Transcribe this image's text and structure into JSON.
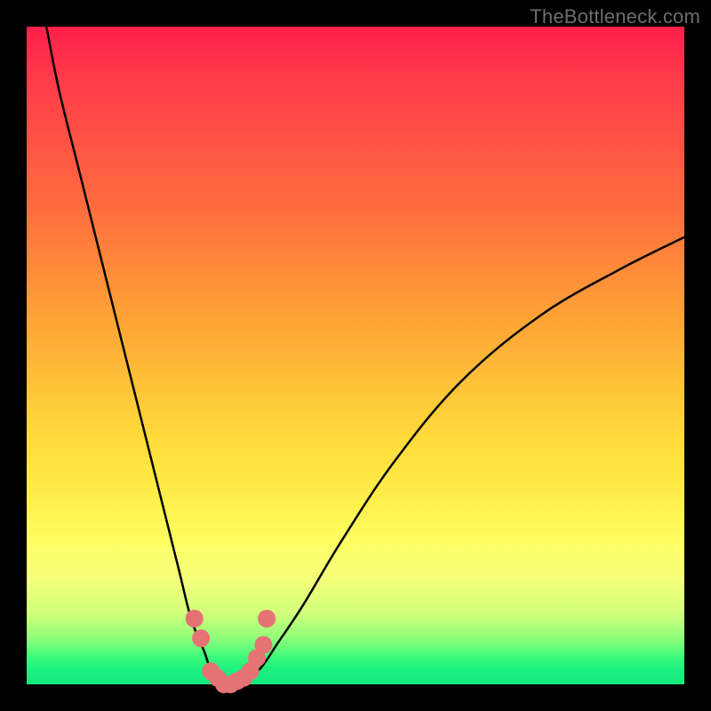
{
  "watermark": "TheBottleneck.com",
  "colors": {
    "frame": "#000000",
    "curve_stroke": "#000000",
    "marker_fill": "#e57373",
    "marker_stroke": "#d16060",
    "gradient_top": "#ff1f4a",
    "gradient_mid": "#ffd93a",
    "gradient_bottom": "#16e87f"
  },
  "chart_data": {
    "type": "line",
    "title": "",
    "xlabel": "",
    "ylabel": "",
    "xlim": [
      0,
      100
    ],
    "ylim": [
      0,
      100
    ],
    "grid": false,
    "legend": false,
    "series": [
      {
        "name": "bottleneck-curve",
        "x": [
          3,
          5,
          8,
          12,
          16,
          20,
          23,
          25,
          27,
          28,
          29,
          30,
          31,
          32,
          34,
          36,
          38,
          42,
          48,
          56,
          66,
          78,
          90,
          100
        ],
        "y": [
          100,
          90,
          78,
          62,
          46,
          30,
          18,
          10,
          5,
          2,
          0,
          0,
          0,
          0,
          1,
          3,
          6,
          12,
          22,
          34,
          46,
          56,
          63,
          68
        ]
      }
    ],
    "markers": [
      {
        "x": 25.5,
        "y": 10
      },
      {
        "x": 26.5,
        "y": 7
      },
      {
        "x": 28,
        "y": 2
      },
      {
        "x": 29,
        "y": 1
      },
      {
        "x": 30,
        "y": 0
      },
      {
        "x": 31,
        "y": 0
      },
      {
        "x": 32,
        "y": 0.5
      },
      {
        "x": 33,
        "y": 1
      },
      {
        "x": 34,
        "y": 2
      },
      {
        "x": 35,
        "y": 4
      },
      {
        "x": 36,
        "y": 6
      },
      {
        "x": 36.5,
        "y": 10
      }
    ],
    "annotations": []
  }
}
